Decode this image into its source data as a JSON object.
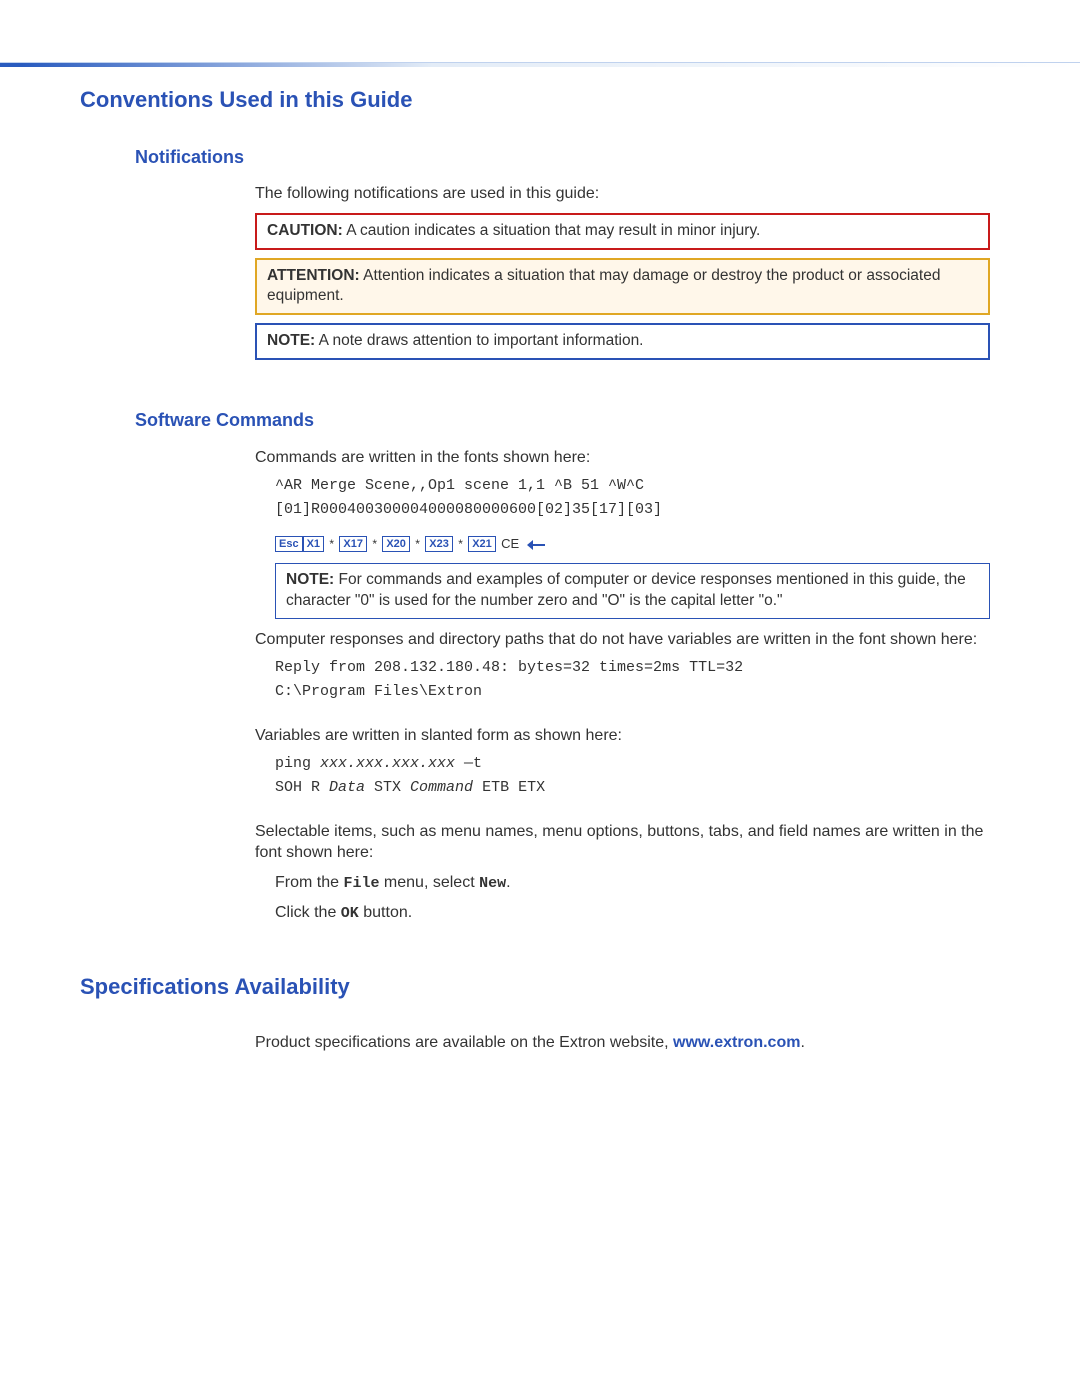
{
  "h1_conventions": "Conventions Used in this Guide",
  "notifications": {
    "heading": "Notifications",
    "intro": "The following notifications are used in this guide:",
    "caution_label": "CAUTION:",
    "caution_text": "A caution indicates a situation that may result in minor injury.",
    "attention_label": "ATTENTION:",
    "attention_text": "Attention indicates a situation that may damage or destroy the product or associated equipment.",
    "note_label": "NOTE:",
    "note_text": "A note draws attention to important information."
  },
  "software": {
    "heading": "Software Commands",
    "intro": "Commands are written in the fonts shown here:",
    "cmd1": "^AR Merge Scene,,Op1 scene 1,1 ^B 51 ^W^C",
    "cmd2": "[01]R000400300004000080000600[02]35[17][03]",
    "tokens": {
      "esc": "Esc",
      "x1": "X1",
      "x17": "X17",
      "x20": "X20",
      "x23": "X23",
      "x21": "X21",
      "star": "*",
      "ce": "CE"
    },
    "note2_label": "NOTE:",
    "note2_text": "For commands and examples of computer or device responses mentioned in this guide, the character \"0\" is used for the number zero and \"O\" is the capital letter \"o.\"",
    "responses_intro": "Computer responses and directory paths that do not have variables are written in the font shown here:",
    "resp1": "Reply from 208.132.180.48: bytes=32 times=2ms TTL=32",
    "resp2": "C:\\Program Files\\Extron",
    "vars_intro": "Variables are written in slanted form as shown here:",
    "var_ping_a": "ping ",
    "var_ping_b": "xxx.xxx.xxx.xxx",
    "var_ping_c": " —t",
    "var_soh_a": "SOH R ",
    "var_soh_b": "Data",
    "var_soh_c": " STX ",
    "var_soh_d": "Command",
    "var_soh_e": " ETB ETX",
    "selectable_intro": "Selectable items, such as menu names, menu options, buttons, tabs, and field names are written in the font shown here:",
    "sel1_a": "From the ",
    "sel1_b": "File",
    "sel1_c": " menu, select ",
    "sel1_d": "New",
    "sel1_e": ".",
    "sel2_a": "Click the ",
    "sel2_b": "OK",
    "sel2_c": " button."
  },
  "specs": {
    "heading": "Specifications Availability",
    "text_a": "Product specifications are available on the Extron website, ",
    "link": "www.extron.com",
    "text_b": "."
  }
}
